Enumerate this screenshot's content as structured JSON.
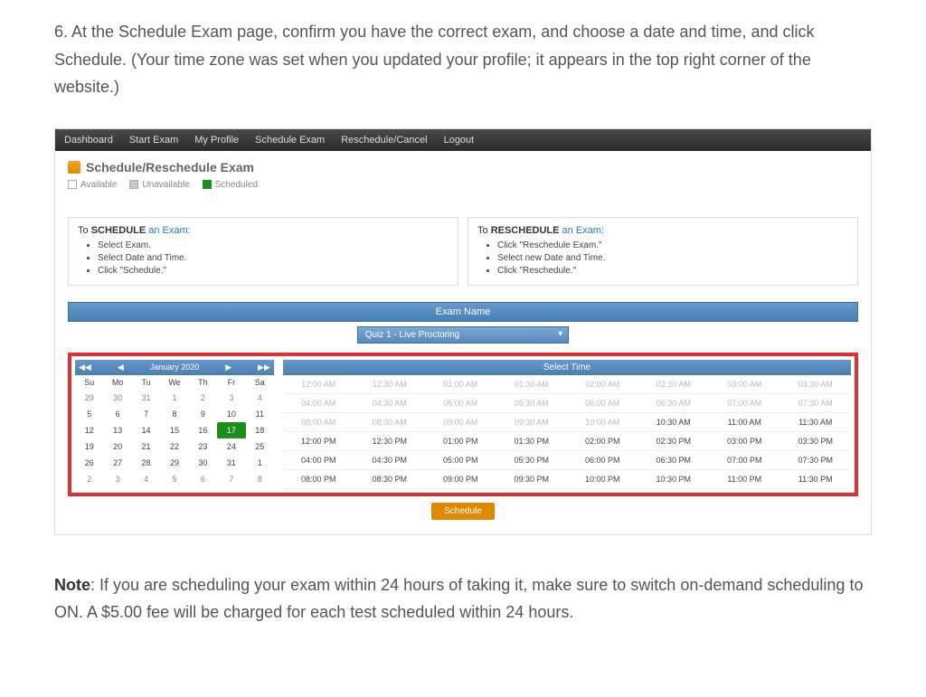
{
  "instruction": "6. At the Schedule Exam page, confirm you have the correct exam, and choose a date and time, and click Schedule. (Your time zone was set when you updated your profile; it appears in the top right corner of the website.)",
  "nav": [
    "Dashboard",
    "Start Exam",
    "My Profile",
    "Schedule Exam",
    "Reschedule/Cancel",
    "Logout"
  ],
  "page_title": "Schedule/Reschedule Exam",
  "legend": {
    "available": "Available",
    "unavailable": "Unavailable",
    "scheduled": "Scheduled"
  },
  "schedule_box": {
    "prefix": "To ",
    "strong": "SCHEDULE",
    "suffix": " an Exam:",
    "items": [
      "Select Exam.",
      "Select Date and Time.",
      "Click \"Schedule.\""
    ]
  },
  "reschedule_box": {
    "prefix": "To ",
    "strong": "RESCHEDULE",
    "suffix": " an Exam:",
    "items": [
      "Click \"Reschedule Exam.\"",
      "Select new Date and Time.",
      "Click \"Reschedule.\""
    ]
  },
  "exam_name_header": "Exam Name",
  "exam_dropdown": "Quiz 1 - Live Proctoring",
  "calendar": {
    "month": "January 2020",
    "nav_prev2": "◀◀",
    "nav_prev": "◀",
    "nav_next": "▶",
    "nav_next2": "▶▶",
    "dow": [
      "Su",
      "Mo",
      "Tu",
      "We",
      "Th",
      "Fr",
      "Sa"
    ],
    "weeks": [
      [
        "29",
        "30",
        "31",
        "1",
        "2",
        "3",
        "4"
      ],
      [
        "5",
        "6",
        "7",
        "8",
        "9",
        "10",
        "11"
      ],
      [
        "12",
        "13",
        "14",
        "15",
        "16",
        "17",
        "18"
      ],
      [
        "19",
        "20",
        "21",
        "22",
        "23",
        "24",
        "25"
      ],
      [
        "26",
        "27",
        "28",
        "29",
        "30",
        "31",
        "1"
      ],
      [
        "2",
        "3",
        "4",
        "5",
        "6",
        "7",
        "8"
      ]
    ],
    "selected": "17"
  },
  "select_time_header": "Select Time",
  "time_rows": [
    {
      "enabled": false,
      "slots": [
        "12:00 AM",
        "12:30 AM",
        "01:00 AM",
        "01:30 AM",
        "02:00 AM",
        "02:30 AM",
        "03:00 AM",
        "03:30 AM"
      ]
    },
    {
      "enabled": false,
      "slots": [
        "04:00 AM",
        "04:30 AM",
        "05:00 AM",
        "05:30 AM",
        "06:00 AM",
        "06:30 AM",
        "07:00 AM",
        "07:30 AM"
      ]
    },
    {
      "enabled": false,
      "partial": 5,
      "slots": [
        "08:00 AM",
        "08:30 AM",
        "09:00 AM",
        "09:30 AM",
        "10:00 AM",
        "10:30 AM",
        "11:00 AM",
        "11:30 AM"
      ]
    },
    {
      "enabled": true,
      "slots": [
        "12:00 PM",
        "12:30 PM",
        "01:00 PM",
        "01:30 PM",
        "02:00 PM",
        "02:30 PM",
        "03:00 PM",
        "03:30 PM"
      ]
    },
    {
      "enabled": true,
      "slots": [
        "04:00 PM",
        "04:30 PM",
        "05:00 PM",
        "05:30 PM",
        "06:00 PM",
        "06:30 PM",
        "07:00 PM",
        "07:30 PM"
      ]
    },
    {
      "enabled": true,
      "slots": [
        "08:00 PM",
        "08:30 PM",
        "09:00 PM",
        "09:30 PM",
        "10:00 PM",
        "10:30 PM",
        "11:00 PM",
        "11:30 PM"
      ]
    }
  ],
  "schedule_button": "Schedule",
  "note_strong": "Note",
  "note_text": ": If you are scheduling your exam within 24 hours of taking it, make sure to switch on-demand scheduling to ON. A $5.00 fee will be charged for each test scheduled within 24 hours."
}
